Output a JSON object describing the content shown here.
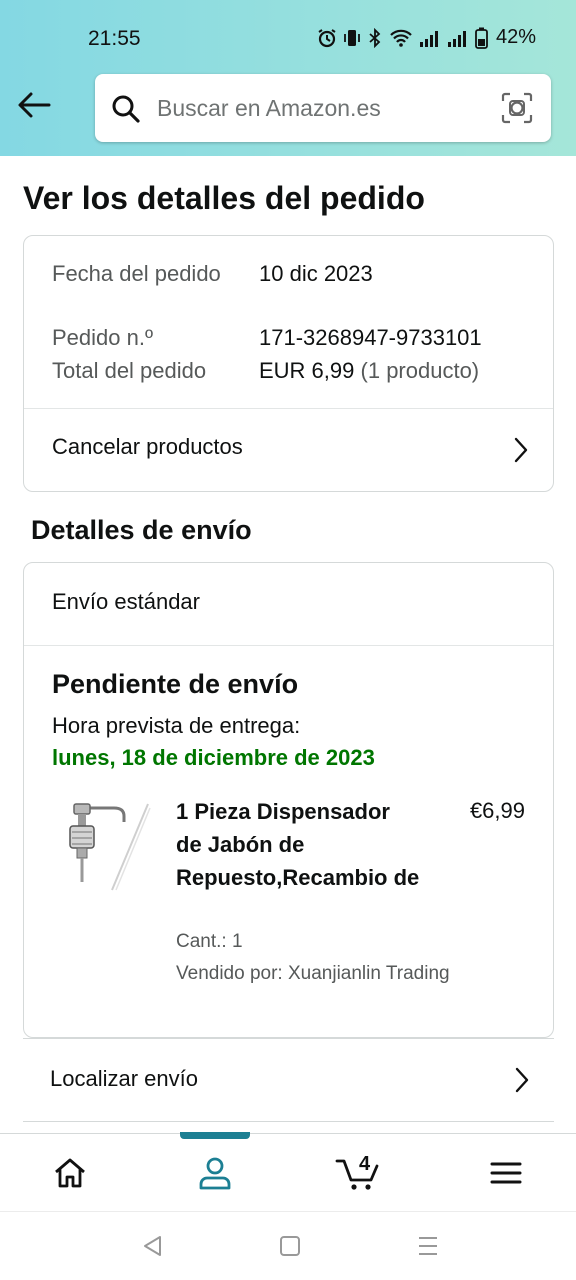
{
  "status_bar": {
    "time": "21:55",
    "battery": "42%"
  },
  "search": {
    "placeholder": "Buscar en Amazon.es"
  },
  "page": {
    "title": "Ver los detalles del pedido"
  },
  "order_summary": {
    "date_label": "Fecha del pedido",
    "date_value": "10 dic 2023",
    "number_label": "Pedido n.º",
    "number_value": "171-3268947-9733101",
    "total_label": "Total del pedido",
    "total_value": "EUR 6,99",
    "total_items": "(1 producto)",
    "cancel_label": "Cancelar productos"
  },
  "shipping": {
    "section_title": "Detalles de envío",
    "method": "Envío estándar",
    "status": "Pendiente de envío",
    "eta_label": "Hora prevista de entrega:",
    "eta_date": "lunes, 18 de diciembre de 2023",
    "eta_color": "#007600",
    "item": {
      "title": "1 Pieza Dispensador de Jabón de Repuesto,Recambio de",
      "price": "€6,99",
      "quantity": "Cant.: 1",
      "seller": "Vendido por: Xuanjianlin Trading"
    },
    "track_label": "Localizar envío"
  },
  "bottom_nav": {
    "items": [
      "home-icon",
      "account-icon",
      "cart-icon",
      "menu-icon"
    ],
    "active": "account-icon",
    "active_color": "#1c7f93",
    "cart_count": "4"
  }
}
